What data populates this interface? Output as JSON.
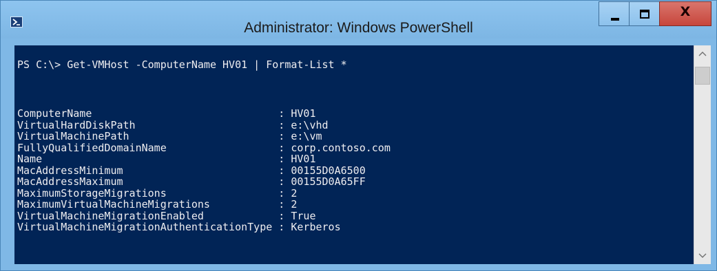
{
  "window": {
    "title": "Administrator: Windows PowerShell",
    "icon": "powershell-icon",
    "controls": {
      "minimize": "minimize-icon",
      "maximize": "maximize-icon",
      "close_label": "X"
    }
  },
  "console": {
    "background": "#012456",
    "foreground": "#eeedf0",
    "command_line": "PS C:\\> Get-VMHost -ComputerName HV01 | Format-List *",
    "output": [
      {
        "label": "ComputerName",
        "value": "HV01"
      },
      {
        "label": "VirtualHardDiskPath",
        "value": "e:\\vhd"
      },
      {
        "label": "VirtualMachinePath",
        "value": "e:\\vm"
      },
      {
        "label": "FullyQualifiedDomainName",
        "value": "corp.contoso.com"
      },
      {
        "label": "Name",
        "value": "HV01"
      },
      {
        "label": "MacAddressMinimum",
        "value": "00155D0A6500"
      },
      {
        "label": "MacAddressMaximum",
        "value": "00155D0A65FF"
      },
      {
        "label": "MaximumStorageMigrations",
        "value": "2"
      },
      {
        "label": "MaximumVirtualMachineMigrations",
        "value": "2"
      },
      {
        "label": "VirtualMachineMigrationEnabled",
        "value": "True"
      },
      {
        "label": "VirtualMachineMigrationAuthenticationType",
        "value": "Kerberos"
      }
    ]
  },
  "scrollbar": {
    "up_icon": "chevron-up-icon",
    "down_icon": "chevron-down-icon"
  }
}
